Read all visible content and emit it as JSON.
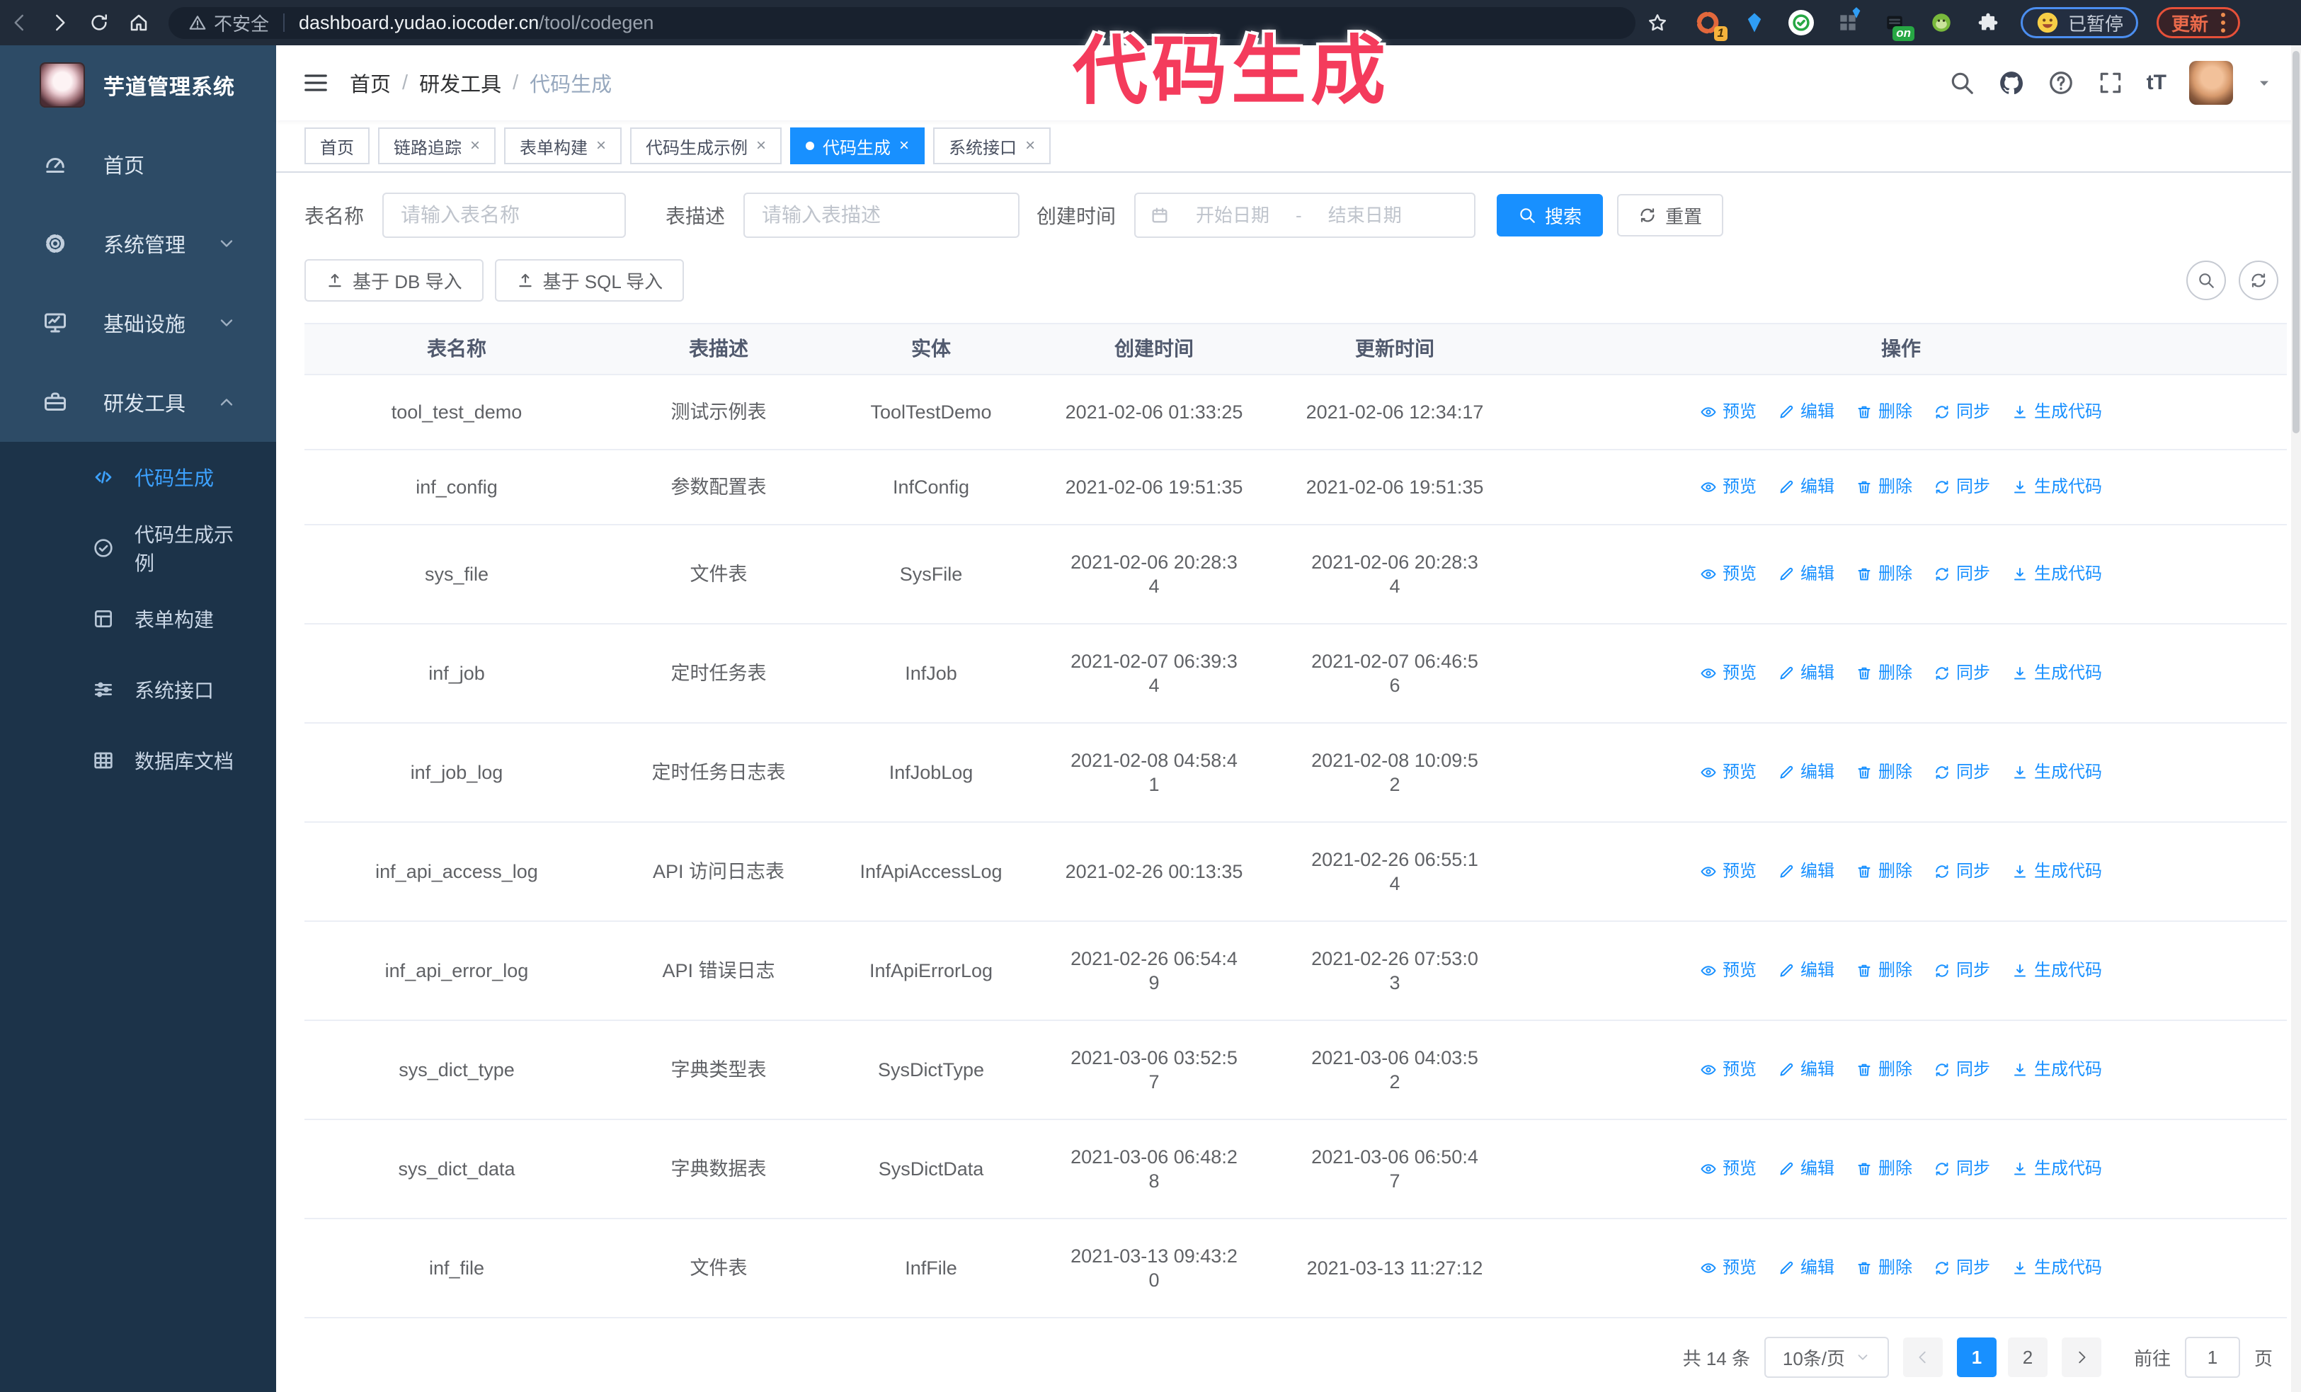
{
  "browser": {
    "security_label": "不安全",
    "url_host": "dashboard.yudao.iocoder.cn",
    "url_path": "/tool/codegen",
    "paused_badge": "已暂停",
    "update_button": "更新",
    "extensions": [
      {
        "icon": "orange-swirl-extension-icon",
        "badge": "1"
      },
      {
        "icon": "blue-gem-extension-icon",
        "badge": ""
      },
      {
        "icon": "green-check-extension-icon",
        "badge": ""
      },
      {
        "icon": "grid-gem-extension-icon",
        "badge": ""
      },
      {
        "icon": "dark-box-extension-icon",
        "badge": "on"
      },
      {
        "icon": "green-monkey-extension-icon",
        "badge": ""
      },
      {
        "icon": "puzzle-extension-icon",
        "badge": ""
      }
    ]
  },
  "annotation": {
    "text": "代码生成",
    "color": "#f43b5c"
  },
  "sidebar": {
    "logo_title": "芋道管理系统",
    "items": [
      {
        "label": "首页",
        "icon": "dashboard-icon",
        "chevron": ""
      },
      {
        "label": "系统管理",
        "icon": "gear-icon",
        "chevron": "down"
      },
      {
        "label": "基础设施",
        "icon": "infra-icon",
        "chevron": "down"
      },
      {
        "label": "研发工具",
        "icon": "toolbox-icon",
        "chevron": "up"
      }
    ],
    "submenu": [
      {
        "label": "代码生成",
        "icon": "code-icon",
        "active": true
      },
      {
        "label": "代码生成示例",
        "icon": "example-icon",
        "active": false
      },
      {
        "label": "表单构建",
        "icon": "form-icon",
        "active": false
      },
      {
        "label": "系统接口",
        "icon": "api-icon",
        "active": false
      },
      {
        "label": "数据库文档",
        "icon": "database-icon",
        "active": false
      }
    ]
  },
  "header": {
    "breadcrumb": [
      "首页",
      "研发工具",
      "代码生成"
    ]
  },
  "tabs": [
    {
      "label": "首页",
      "closable": false,
      "active": false
    },
    {
      "label": "链路追踪",
      "closable": true,
      "active": false
    },
    {
      "label": "表单构建",
      "closable": true,
      "active": false
    },
    {
      "label": "代码生成示例",
      "closable": true,
      "active": false
    },
    {
      "label": "代码生成",
      "closable": true,
      "active": true
    },
    {
      "label": "系统接口",
      "closable": true,
      "active": false
    }
  ],
  "filters": {
    "table_name_label": "表名称",
    "table_name_placeholder": "请输入表名称",
    "table_desc_label": "表描述",
    "table_desc_placeholder": "请输入表描述",
    "create_time_label": "创建时间",
    "date_start_placeholder": "开始日期",
    "date_separator": "-",
    "date_end_placeholder": "结束日期",
    "search_button": "搜索",
    "reset_button": "重置"
  },
  "toolbar": {
    "import_db_button": "基于 DB 导入",
    "import_sql_button": "基于 SQL 导入"
  },
  "table": {
    "columns": [
      "表名称",
      "表描述",
      "实体",
      "创建时间",
      "更新时间",
      "操作"
    ],
    "action_labels": [
      "预览",
      "编辑",
      "删除",
      "同步",
      "生成代码"
    ],
    "rows": [
      {
        "name": "tool_test_demo",
        "desc": "测试示例表",
        "entity": "ToolTestDemo",
        "created": "2021-02-06 01:33:25",
        "updated": "2021-02-06 12:34:17"
      },
      {
        "name": "inf_config",
        "desc": "参数配置表",
        "entity": "InfConfig",
        "created": "2021-02-06 19:51:35",
        "updated": "2021-02-06 19:51:35"
      },
      {
        "name": "sys_file",
        "desc": "文件表",
        "entity": "SysFile",
        "created": "2021-02-06 20:28:3\n4",
        "updated": "2021-02-06 20:28:3\n4"
      },
      {
        "name": "inf_job",
        "desc": "定时任务表",
        "entity": "InfJob",
        "created": "2021-02-07 06:39:3\n4",
        "updated": "2021-02-07 06:46:5\n6"
      },
      {
        "name": "inf_job_log",
        "desc": "定时任务日志表",
        "entity": "InfJobLog",
        "created": "2021-02-08 04:58:4\n1",
        "updated": "2021-02-08 10:09:5\n2"
      },
      {
        "name": "inf_api_access_log",
        "desc": "API 访问日志表",
        "entity": "InfApiAccessLog",
        "created": "2021-02-26 00:13:35",
        "updated": "2021-02-26 06:55:1\n4"
      },
      {
        "name": "inf_api_error_log",
        "desc": "API 错误日志",
        "entity": "InfApiErrorLog",
        "created": "2021-02-26 06:54:4\n9",
        "updated": "2021-02-26 07:53:0\n3"
      },
      {
        "name": "sys_dict_type",
        "desc": "字典类型表",
        "entity": "SysDictType",
        "created": "2021-03-06 03:52:5\n7",
        "updated": "2021-03-06 04:03:5\n2"
      },
      {
        "name": "sys_dict_data",
        "desc": "字典数据表",
        "entity": "SysDictData",
        "created": "2021-03-06 06:48:2\n8",
        "updated": "2021-03-06 06:50:4\n7"
      },
      {
        "name": "inf_file",
        "desc": "文件表",
        "entity": "InfFile",
        "created": "2021-03-13 09:43:2\n0",
        "updated": "2021-03-13 11:27:12"
      }
    ]
  },
  "pagination": {
    "total": "共 14 条",
    "page_size": "10条/页",
    "pages": [
      "1",
      "2"
    ],
    "active_page": "1",
    "goto_label": "前往",
    "goto_value": "1",
    "goto_suffix": "页"
  },
  "colors": {
    "accent_blue": "#1890ff",
    "annotation_pink": "#f43b5c",
    "sidebar_top_bg": "#2d4b66",
    "sidebar_sub_bg": "#1c3349",
    "browser_bar_bg": "#212b39",
    "active_menu_text": "#3da2ff"
  }
}
